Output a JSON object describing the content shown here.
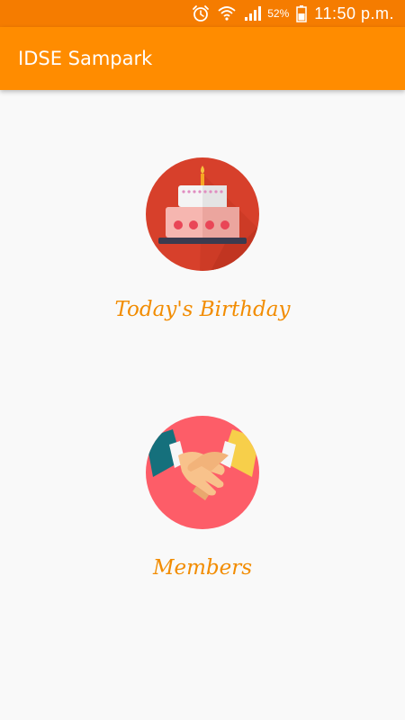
{
  "status_bar": {
    "battery_percent": "52%",
    "time": "11:50 p.m.",
    "icons": [
      "alarm-clock-icon",
      "wifi-icon",
      "signal-icon",
      "battery-icon"
    ]
  },
  "app_bar": {
    "title": "IDSE Sampark"
  },
  "menu": {
    "birthday": {
      "label": "Today's Birthday",
      "icon": "birthday-cake-icon"
    },
    "members": {
      "label": "Members",
      "icon": "handshake-icon"
    }
  },
  "colors": {
    "status_bar": "#f57c00",
    "app_bar": "#ff8c00",
    "label": "#f28c00",
    "background": "#f9f9f9"
  }
}
